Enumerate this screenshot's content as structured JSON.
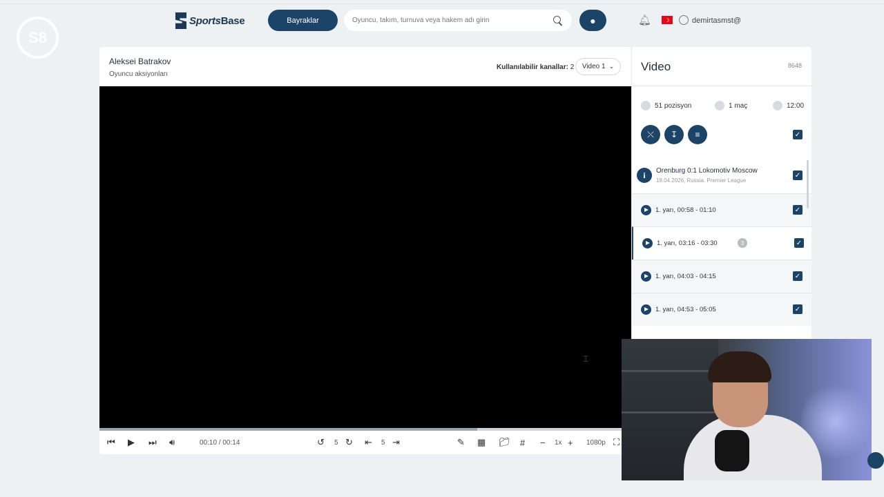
{
  "header": {
    "watermark": "S8",
    "logo_text_a": "Sports",
    "logo_text_b": "Base",
    "flags_button": "Bayraklar",
    "search_placeholder": "Oyuncu, takım, turnuva veya hakem adı girin",
    "user_name": "demirtasmst@"
  },
  "player": {
    "name": "Aleksei Batrakov",
    "subtitle": "Oyuncu aksiyonları",
    "channels_label": "Kullanılabilir kanallar:",
    "channels_count": "2",
    "video_select": "Video 1"
  },
  "controls": {
    "time": "00:10 / 00:14",
    "progress": 0.71,
    "rewind_seconds": "5",
    "frame_step": "5",
    "speed": "1x",
    "quality": "1080p"
  },
  "side": {
    "title": "Video",
    "count": "8648",
    "stats": {
      "positions": "51 pozisyon",
      "matches": "1 maç",
      "duration": "12:00"
    },
    "match": {
      "title": "Orenburg 0:1 Lokomotiv Moscow",
      "subtitle": "18.04.2026, Russia. Premier League"
    },
    "clips": [
      {
        "label": "1. yarı, 00:58 - 01:10",
        "badge": ""
      },
      {
        "label": "1. yarı, 03:16 - 03:30",
        "badge": "3"
      },
      {
        "label": "1. yarı, 04:03 - 04:15",
        "badge": ""
      },
      {
        "label": "1. yarı, 04:53 - 05:05",
        "badge": ""
      }
    ]
  },
  "colors": {
    "primary": "#1c4466",
    "background": "#eef1f3",
    "video_bg": "#000000"
  }
}
